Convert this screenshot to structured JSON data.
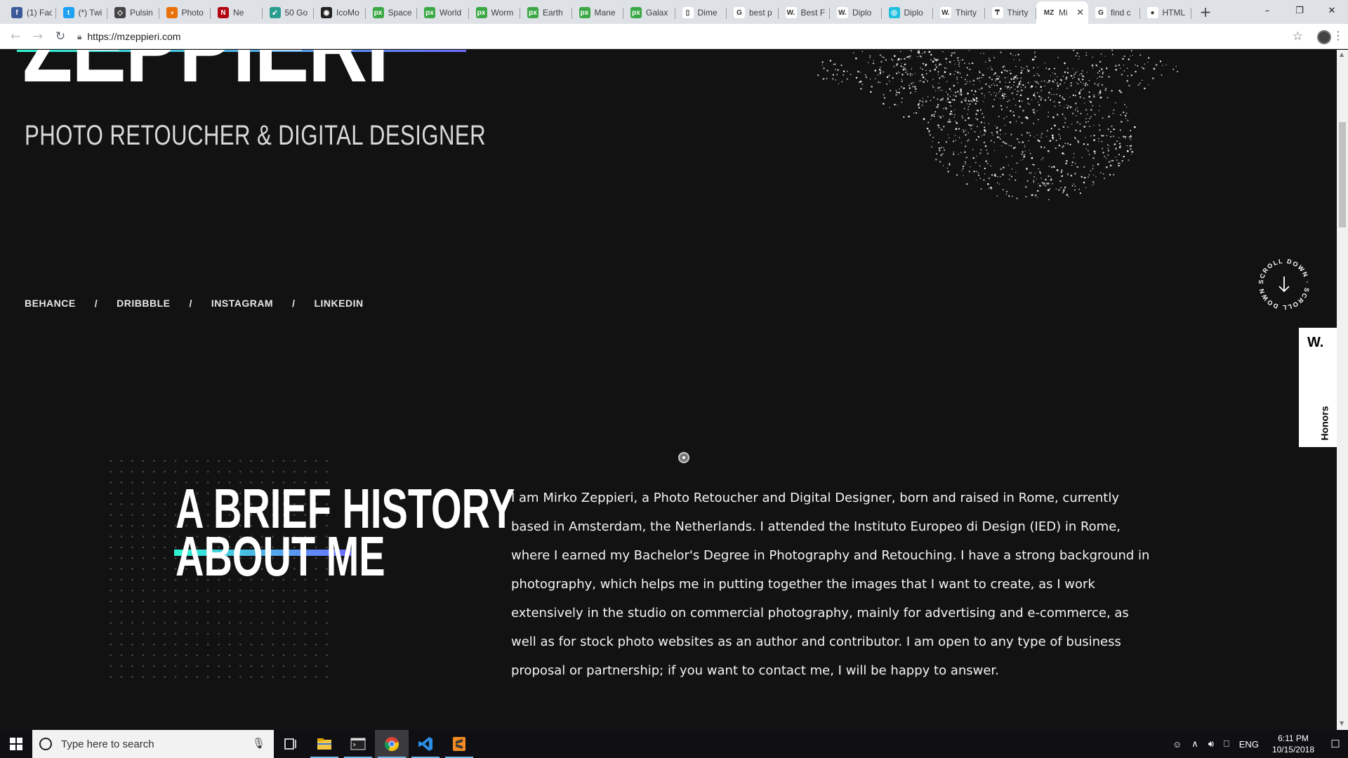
{
  "browser": {
    "tabs": [
      {
        "label": "(1) Fac",
        "icon": "facebook-icon",
        "color": "#3b5998",
        "glyph": "f"
      },
      {
        "label": "(*) Twi",
        "icon": "twitter-icon",
        "color": "#1da1f2",
        "glyph": "t"
      },
      {
        "label": "Pulsin",
        "icon": "codepen-icon",
        "color": "#444444",
        "glyph": "◇"
      },
      {
        "label": "Photo",
        "icon": "photo-icon",
        "color": "#e8710a",
        "glyph": "◑"
      },
      {
        "label": "Ne",
        "icon": "netflix-icon",
        "color": "#b20710",
        "glyph": "N"
      },
      {
        "label": "50 Go",
        "icon": "bird-icon",
        "color": "#2a9d8f",
        "glyph": "➹"
      },
      {
        "label": "IcoMo",
        "icon": "icomoon-icon",
        "color": "#222222",
        "glyph": "◉"
      },
      {
        "label": "Space",
        "icon": "px-icon",
        "color": "#3aa845",
        "glyph": "px"
      },
      {
        "label": "World",
        "icon": "px-icon",
        "color": "#3aa845",
        "glyph": "px"
      },
      {
        "label": "Worm",
        "icon": "px-icon",
        "color": "#3aa845",
        "glyph": "px"
      },
      {
        "label": "Earth",
        "icon": "px-icon",
        "color": "#3aa845",
        "glyph": "px"
      },
      {
        "label": "Mane",
        "icon": "px-icon",
        "color": "#3aa845",
        "glyph": "px"
      },
      {
        "label": "Galax",
        "icon": "px-icon",
        "color": "#3aa845",
        "glyph": "px"
      },
      {
        "label": "Dime",
        "icon": "page-icon",
        "color": "#ffffff",
        "glyph": "▯"
      },
      {
        "label": "best p",
        "icon": "google-icon",
        "color": "#ffffff",
        "glyph": "G"
      },
      {
        "label": "Best F",
        "icon": "w-icon",
        "color": "#ffffff",
        "glyph": "W."
      },
      {
        "label": "Diplo",
        "icon": "w-icon",
        "color": "#ffffff",
        "glyph": "W."
      },
      {
        "label": "Diplo",
        "icon": "diplo-icon",
        "color": "#20c0e0",
        "glyph": "◎"
      },
      {
        "label": "Thirty",
        "icon": "w-icon",
        "color": "#ffffff",
        "glyph": "W."
      },
      {
        "label": "Thirty",
        "icon": "thirty-icon",
        "color": "#ffffff",
        "glyph": "₸"
      },
      {
        "label": "Mi",
        "icon": "mz-icon",
        "color": "#ffffff",
        "glyph": "MZ",
        "active": true
      },
      {
        "label": "find c",
        "icon": "google-icon",
        "color": "#ffffff",
        "glyph": "G"
      },
      {
        "label": "HTML",
        "icon": "html-icon",
        "color": "#ffffff",
        "glyph": "●"
      }
    ],
    "new_tab": "+",
    "url": "https://mzeppieri.com"
  },
  "page": {
    "hero_name": "ZEPPIERI",
    "subtitle": "PHOTO RETOUCHER & DIGITAL DESIGNER",
    "social": [
      "BEHANCE",
      "DRIBBBLE",
      "INSTAGRAM",
      "LINKEDIN"
    ],
    "social_sep": "/",
    "scroll_label": "SCROLL DOWN · SCROLL DOWN ·",
    "honors_logo": "W.",
    "honors_label": "Honors",
    "history_title_line1": "A BRIEF HISTORY",
    "history_title_line2": "ABOUT ME",
    "bio": "I am Mirko Zeppieri, a Photo Retoucher and Digital Designer, born and raised in Rome, currently based in Amsterdam, the Netherlands. I attended the Instituto Europeo di Design (IED) in Rome, where I earned my Bachelor's Degree in Photography and Retouching. I have a strong background in photography, which helps me in putting together the images that I want to create, as I work extensively in the studio on commercial photography, mainly for advertising and e-commerce, as well as for stock photo websites as an author and contributor. I am open to any type of business proposal or partnership; if you want to contact me, I will be happy to answer.",
    "accent_gradient_start": "#2ff5d0",
    "accent_gradient_end": "#6b6bff"
  },
  "taskbar": {
    "search_placeholder": "Type here to search",
    "lang": "ENG",
    "time": "6:11 PM",
    "date": "10/15/2018"
  }
}
